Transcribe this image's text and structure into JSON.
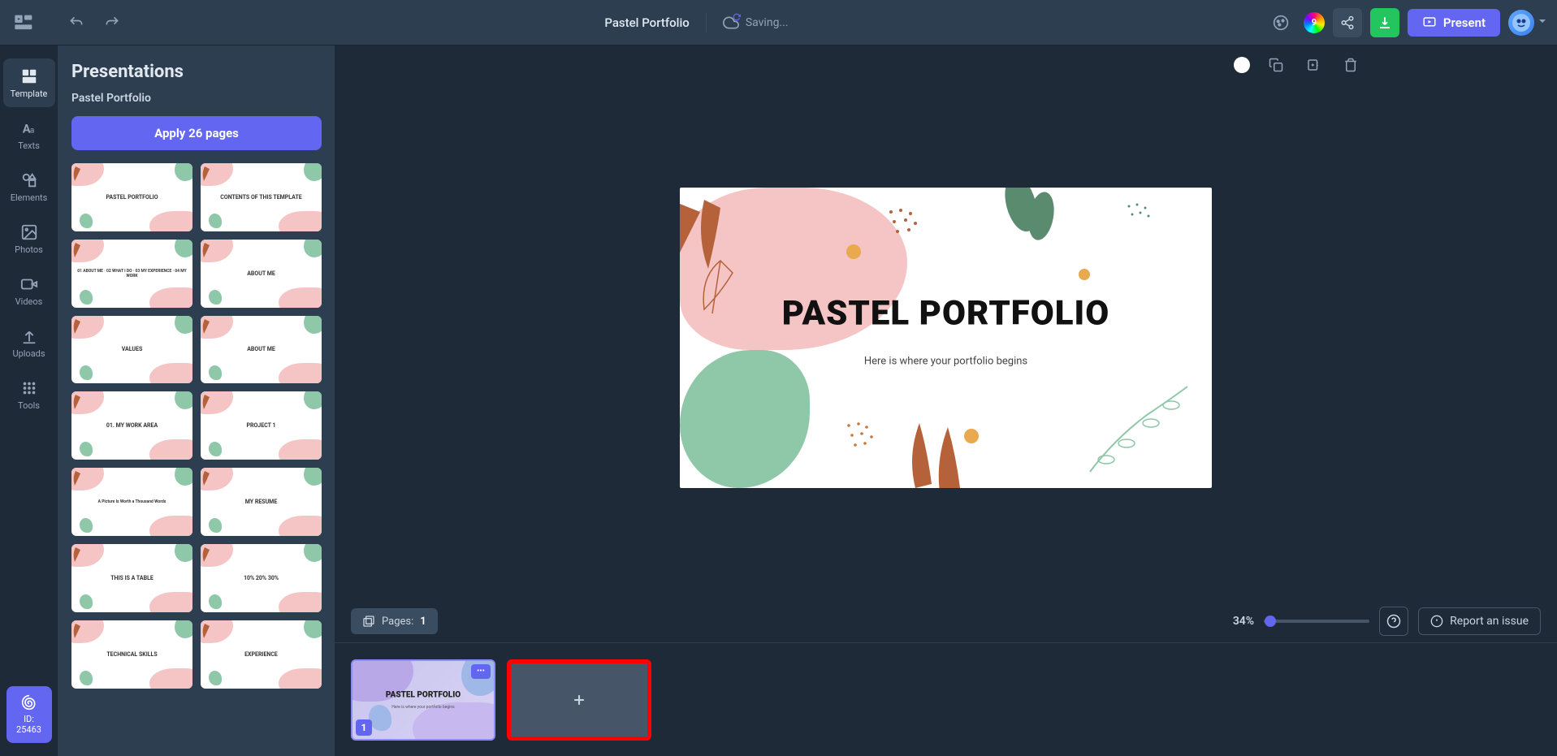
{
  "header": {
    "doc_title": "Pastel Portfolio",
    "saving_label": "Saving...",
    "color_badge": "9",
    "present_label": "Present"
  },
  "sidebar": {
    "items": [
      {
        "label": "Template",
        "icon": "template"
      },
      {
        "label": "Texts",
        "icon": "text"
      },
      {
        "label": "Elements",
        "icon": "shapes"
      },
      {
        "label": "Photos",
        "icon": "image"
      },
      {
        "label": "Videos",
        "icon": "video"
      },
      {
        "label": "Uploads",
        "icon": "upload"
      },
      {
        "label": "Tools",
        "icon": "grid"
      }
    ],
    "id_badge": "ID: 25463"
  },
  "panel": {
    "title": "Presentations",
    "subtitle": "Pastel Portfolio",
    "apply_label": "Apply 26 pages",
    "thumbs": [
      {
        "title": "PASTEL PORTFOLIO"
      },
      {
        "title": "CONTENTS OF THIS TEMPLATE"
      },
      {
        "title": "01 ABOUT ME · 02 WHAT I DO · 03 MY EXPERIENCE · 04 MY WORK"
      },
      {
        "title": "ABOUT ME"
      },
      {
        "title": "VALUES"
      },
      {
        "title": "ABOUT ME"
      },
      {
        "title": "01. MY WORK AREA"
      },
      {
        "title": "PROJECT 1"
      },
      {
        "title": "A Picture Is Worth a Thousand Words"
      },
      {
        "title": "MY RESUME"
      },
      {
        "title": "THIS IS A TABLE"
      },
      {
        "title": "10% 20% 30%"
      },
      {
        "title": "TECHNICAL SKILLS"
      },
      {
        "title": "EXPERIENCE"
      }
    ]
  },
  "slide": {
    "title": "PASTEL PORTFOLIO",
    "subtitle": "Here is where your portfolio begins"
  },
  "footer": {
    "pages_label": "Pages:",
    "pages_count": "1",
    "zoom_pct": "34%",
    "report_label": "Report an issue"
  },
  "filmstrip": {
    "slides": [
      {
        "num": "1",
        "title": "PASTEL PORTFOLIO",
        "subtitle": "Here is where your portfolio begins"
      }
    ]
  },
  "colors": {
    "pink": "#f5c5c5",
    "green": "#8fc7a9",
    "rust": "#b5623a",
    "orange": "#e8a94f",
    "accent": "#6366f1"
  }
}
